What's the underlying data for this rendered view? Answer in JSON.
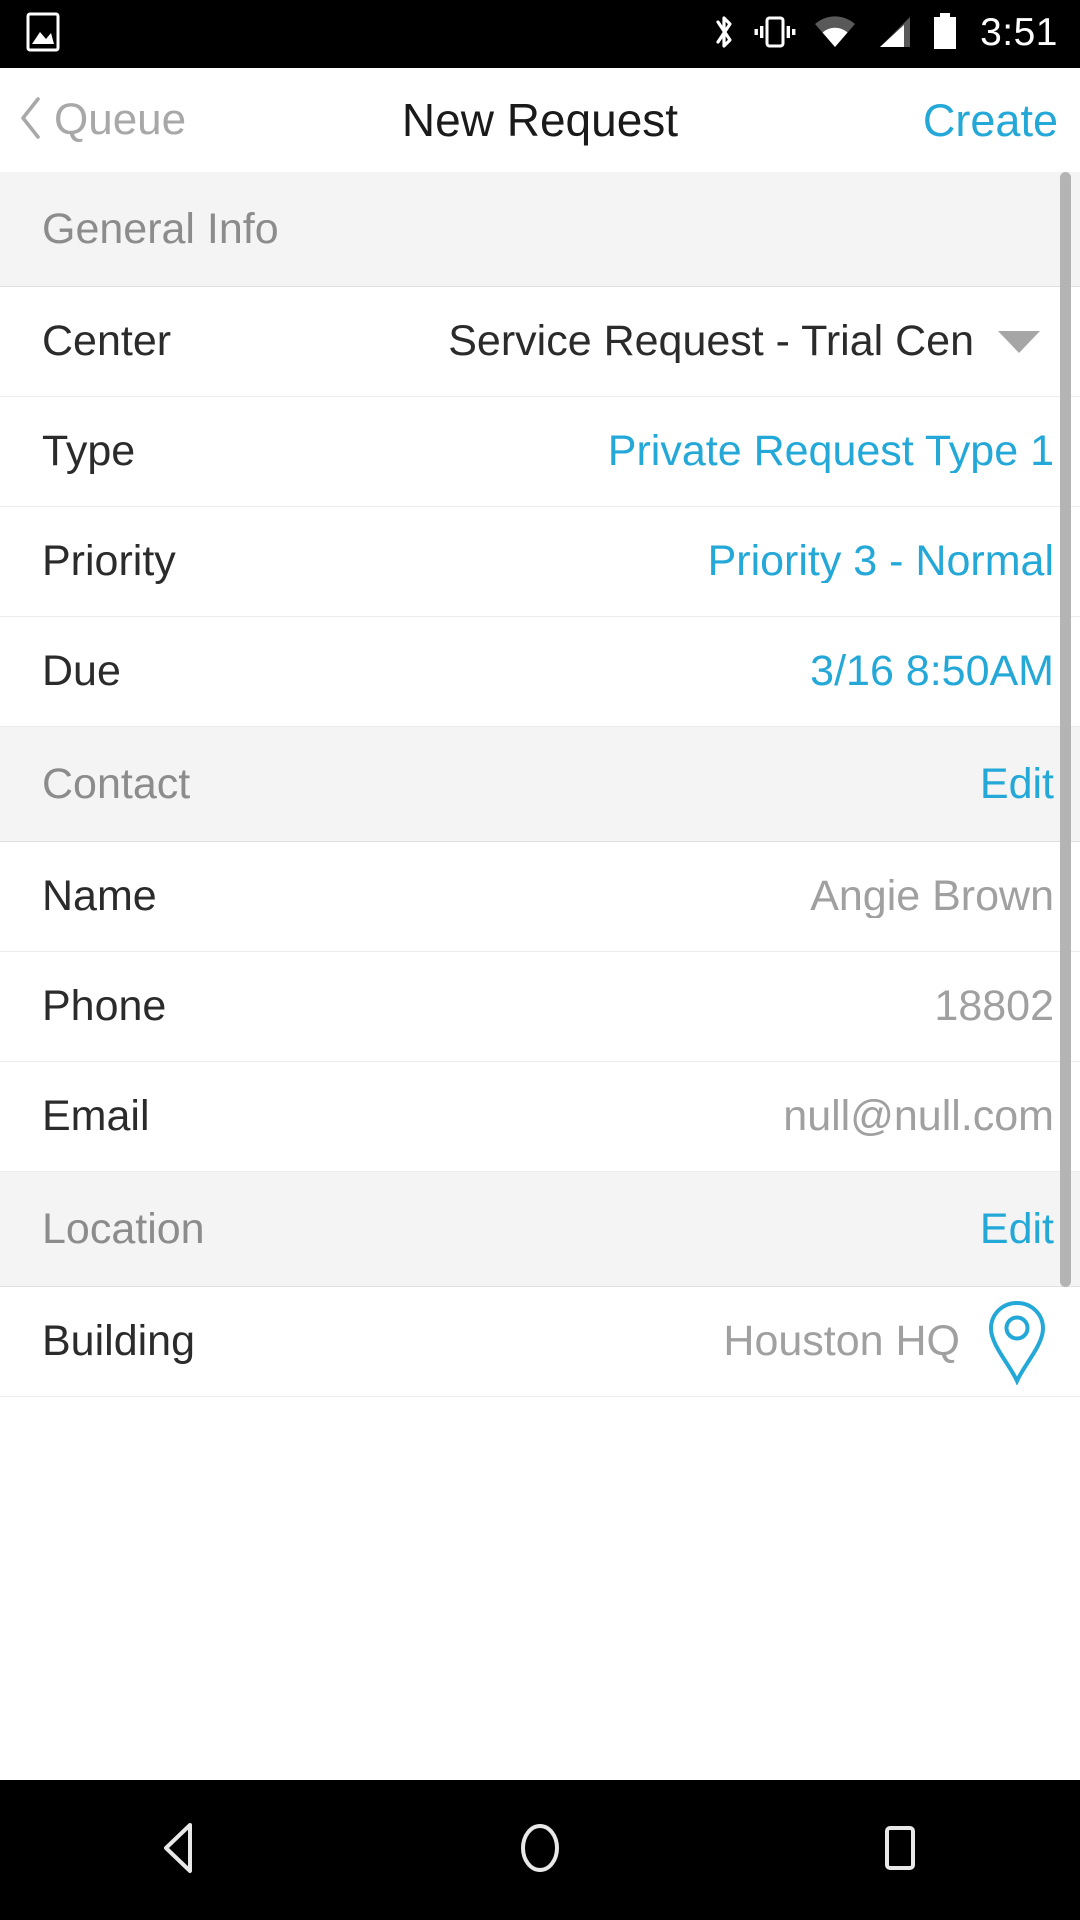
{
  "status_bar": {
    "time": "3:51",
    "icons": [
      "photo-icon",
      "bluetooth-icon",
      "vibrate-icon",
      "wifi-icon",
      "cellular-signal-icon",
      "battery-icon"
    ]
  },
  "nav_bar": {
    "back_label": "Queue",
    "back_icon": "chevron-left-icon",
    "title": "New Request",
    "action_label": "Create"
  },
  "accent_color": "#23a8d8",
  "muted_color": "#a0a0a0",
  "sections": [
    {
      "title": "General Info",
      "action": "",
      "rows": [
        {
          "label": "Center",
          "value": "Service Request - Trial Cen",
          "style": "dark",
          "accessory": "chevron-down-icon"
        },
        {
          "label": "Type",
          "value": "Private Request Type 1",
          "style": "link",
          "accessory": ""
        },
        {
          "label": "Priority",
          "value": "Priority 3 - Normal",
          "style": "link",
          "accessory": ""
        },
        {
          "label": "Due",
          "value": "3/16 8:50AM",
          "style": "link",
          "accessory": ""
        }
      ]
    },
    {
      "title": "Contact",
      "action": "Edit",
      "rows": [
        {
          "label": "Name",
          "value": "Angie Brown",
          "style": "muted",
          "accessory": ""
        },
        {
          "label": "Phone",
          "value": "18802",
          "style": "muted",
          "accessory": ""
        },
        {
          "label": "Email",
          "value": "null@null.com",
          "style": "muted",
          "accessory": ""
        }
      ]
    },
    {
      "title": "Location",
      "action": "Edit",
      "rows": [
        {
          "label": "Building",
          "value": "Houston HQ",
          "style": "muted",
          "accessory": "map-pin-icon"
        }
      ]
    }
  ],
  "system_nav": {
    "back": "back-triangle-icon",
    "home": "home-circle-icon",
    "recents": "recents-square-icon"
  }
}
